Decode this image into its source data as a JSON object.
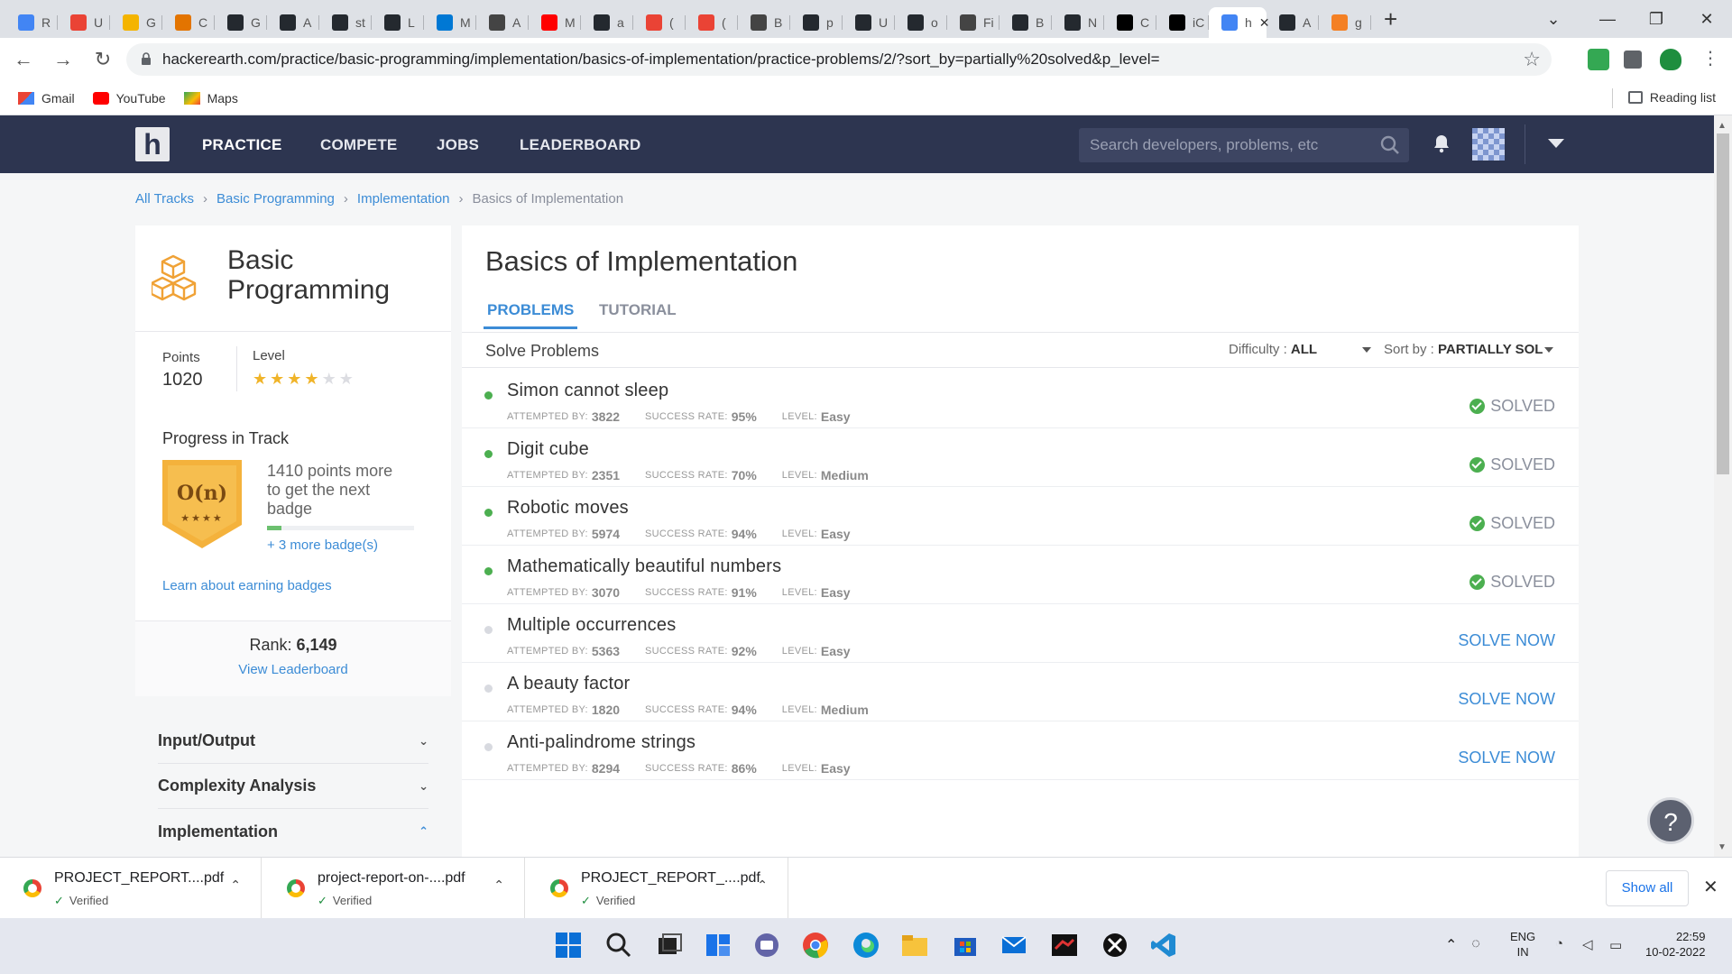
{
  "browser": {
    "tabs": [
      {
        "letter": "R",
        "color": "#4285f4"
      },
      {
        "letter": "U",
        "color": "#ea4335"
      },
      {
        "letter": "G",
        "color": "#f4b400"
      },
      {
        "letter": "C",
        "color": "#e37400"
      },
      {
        "letter": "G",
        "color": "#24292f"
      },
      {
        "letter": "A",
        "color": "#24292f"
      },
      {
        "letter": "st",
        "color": "#24292f"
      },
      {
        "letter": "L",
        "color": "#24292f"
      },
      {
        "letter": "M",
        "color": "#0078d4"
      },
      {
        "letter": "A",
        "color": "#444444"
      },
      {
        "letter": "M",
        "color": "#ff0000"
      },
      {
        "letter": "a",
        "color": "#24292f"
      },
      {
        "letter": "(",
        "color": "#ea4335"
      },
      {
        "letter": "(",
        "color": "#ea4335"
      },
      {
        "letter": "B",
        "color": "#444444"
      },
      {
        "letter": "p",
        "color": "#24292f"
      },
      {
        "letter": "U",
        "color": "#24292f"
      },
      {
        "letter": "o",
        "color": "#24292f"
      },
      {
        "letter": "Fi",
        "color": "#444444"
      },
      {
        "letter": "B",
        "color": "#24292f"
      },
      {
        "letter": "N",
        "color": "#24292f"
      },
      {
        "letter": "C",
        "color": "#000000"
      },
      {
        "letter": "iC",
        "color": "#000000"
      },
      {
        "letter": "h",
        "color": "#4285f4"
      },
      {
        "letter": "A",
        "color": "#24292f"
      },
      {
        "letter": "g",
        "color": "#f48024"
      }
    ],
    "active_tab_letter": "h",
    "url": "hackerearth.com/practice/basic-programming/implementation/basics-of-implementation/practice-problems/2/?sort_by=partially%20solved&p_level=",
    "bookmarks": [
      "Gmail",
      "YouTube",
      "Maps"
    ],
    "reading_list": "Reading list"
  },
  "site": {
    "logo": "h",
    "nav": [
      "PRACTICE",
      "COMPETE",
      "JOBS",
      "LEADERBOARD"
    ],
    "search_placeholder": "Search developers, problems, etc"
  },
  "breadcrumb": [
    "All Tracks",
    "Basic Programming",
    "Implementation",
    "Basics of Implementation"
  ],
  "track": {
    "title": "Basic Programming",
    "points_label": "Points",
    "points": "1020",
    "level_label": "Level",
    "level_stars": 4,
    "level_max": 6,
    "progress_title": "Progress in Track",
    "badge_symbol": "O(n)",
    "badge_stars": "★★★★",
    "badge_text": "1410 points more to get the next badge",
    "badge_progress": 0.1,
    "more_badges": "+ 3 more badge(s)",
    "learn_link": "Learn about earning badges",
    "rank_label": "Rank:",
    "rank": "6,149",
    "view_leaderboard": "View Leaderboard"
  },
  "topics": [
    {
      "label": "Input/Output",
      "expanded": false
    },
    {
      "label": "Complexity Analysis",
      "expanded": false
    },
    {
      "label": "Implementation",
      "expanded": true
    }
  ],
  "main": {
    "title": "Basics of Implementation",
    "tabs": [
      "PROBLEMS",
      "TUTORIAL"
    ],
    "solve_title": "Solve Problems",
    "difficulty_label": "Difficulty :",
    "difficulty_value": "ALL",
    "sort_label": "Sort by :",
    "sort_value": "PARTIALLY SOL",
    "attempted_label": "ATTEMPTED BY:",
    "success_label": "SUCCESS RATE:",
    "level_label": "LEVEL:",
    "problems": [
      {
        "name": "Simon cannot sleep",
        "attempted": "3822",
        "rate": "95%",
        "level": "Easy",
        "status": "SOLVED"
      },
      {
        "name": "Digit cube",
        "attempted": "2351",
        "rate": "70%",
        "level": "Medium",
        "status": "SOLVED"
      },
      {
        "name": "Robotic moves",
        "attempted": "5974",
        "rate": "94%",
        "level": "Easy",
        "status": "SOLVED"
      },
      {
        "name": "Mathematically beautiful numbers",
        "attempted": "3070",
        "rate": "91%",
        "level": "Easy",
        "status": "SOLVED"
      },
      {
        "name": "Multiple occurrences",
        "attempted": "5363",
        "rate": "92%",
        "level": "Easy",
        "status": "SOLVE NOW"
      },
      {
        "name": "A beauty factor",
        "attempted": "1820",
        "rate": "94%",
        "level": "Medium",
        "status": "SOLVE NOW"
      },
      {
        "name": "Anti-palindrome strings",
        "attempted": "8294",
        "rate": "86%",
        "level": "Easy",
        "status": "SOLVE NOW"
      }
    ],
    "help": "?"
  },
  "downloads": {
    "items": [
      {
        "name": "PROJECT_REPORT....pdf",
        "status": "Verified"
      },
      {
        "name": "project-report-on-....pdf",
        "status": "Verified"
      },
      {
        "name": "PROJECT_REPORT_....pdf",
        "status": "Verified"
      }
    ],
    "show_all": "Show all"
  },
  "taskbar": {
    "lang_top": "ENG",
    "lang_bottom": "IN",
    "time": "22:59",
    "date": "10-02-2022"
  },
  "colors": {
    "brand_nav": "#2d3550",
    "link": "#3c8cd6",
    "solved_green": "#4caf50",
    "star": "#f0b429"
  }
}
